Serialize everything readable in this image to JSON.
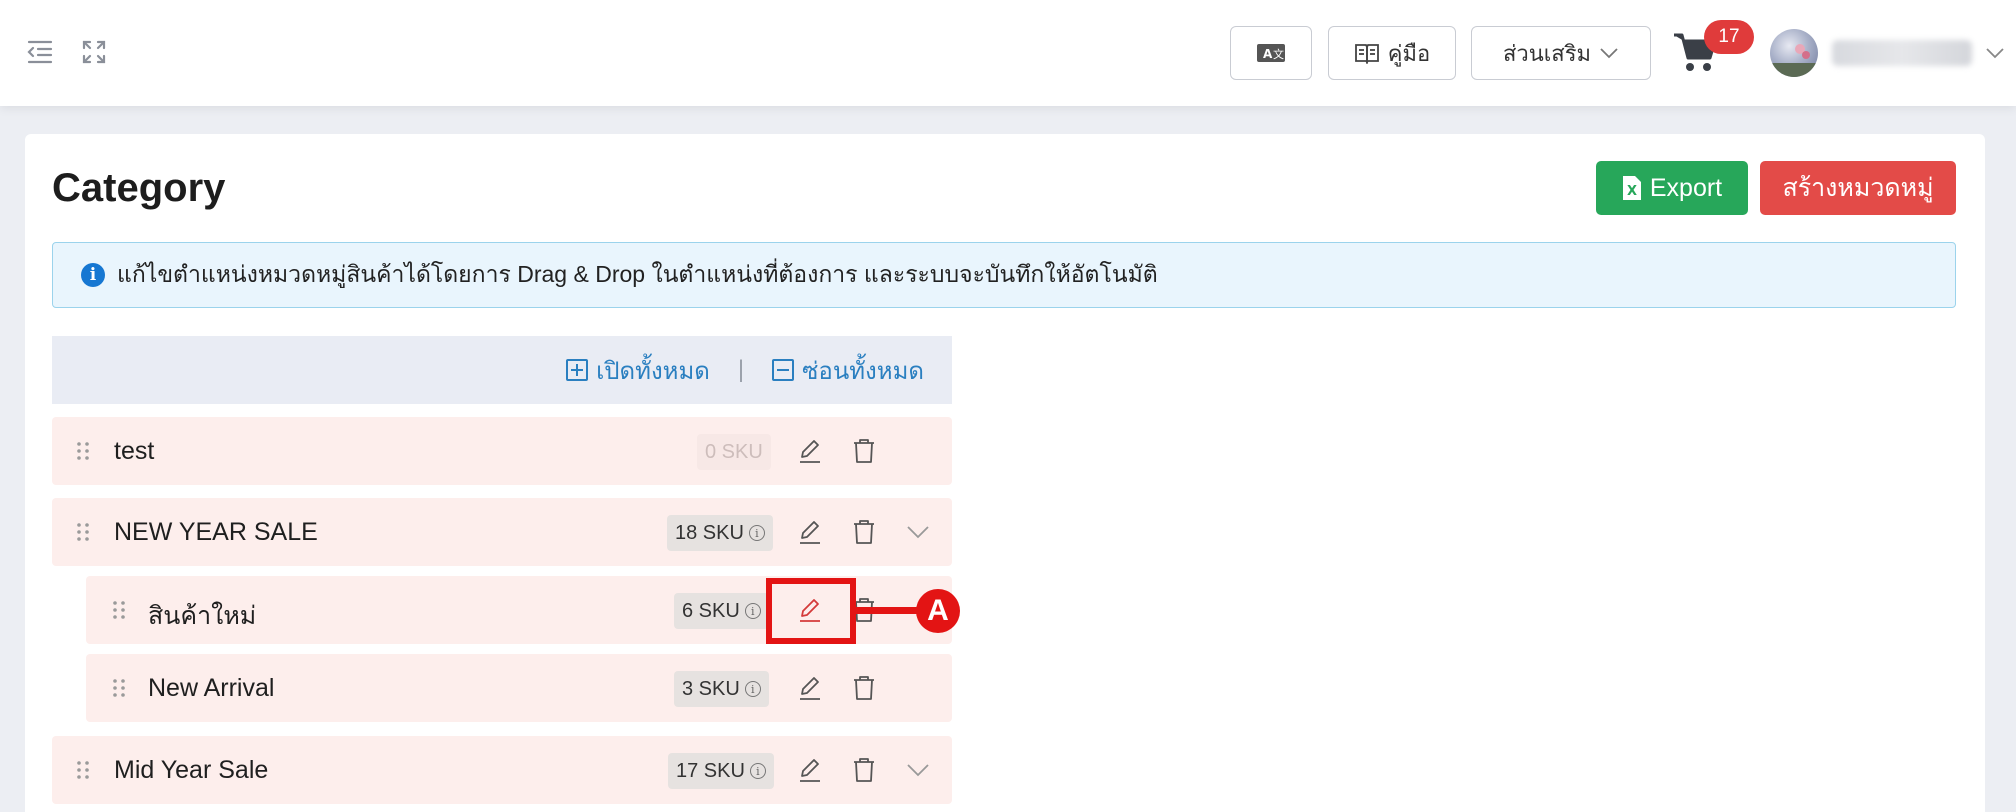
{
  "header": {
    "manual_label": "คู่มือ",
    "addons_label": "ส่วนเสริม",
    "cart_count": "17"
  },
  "page": {
    "title": "Category",
    "export_label": "Export",
    "create_label": "สร้างหมวดหมู่",
    "info_text": "แก้ไขตำแหน่งหมวดหมู่สินค้าได้โดยการ Drag & Drop ในตำแหน่งที่ต้องการ และระบบจะบันทึกให้อัตโนมัติ"
  },
  "tree": {
    "expand_all": "เปิดทั้งหมด",
    "collapse_all": "ซ่อนทั้งหมด",
    "separator": "|",
    "rows": [
      {
        "name": "test",
        "sku": "0 SKU"
      },
      {
        "name": "NEW YEAR SALE",
        "sku": "18 SKU"
      },
      {
        "name": "สินค้าใหม่",
        "sku": "6 SKU"
      },
      {
        "name": "New Arrival",
        "sku": "3 SKU"
      },
      {
        "name": "Mid Year Sale",
        "sku": "17 SKU"
      }
    ]
  },
  "annotation": {
    "label": "A",
    "color": "#e31414"
  },
  "colors": {
    "export": "#27a75a",
    "create": "#e34b48",
    "row_bg": "#fdeeec",
    "link": "#2a7fc0"
  }
}
